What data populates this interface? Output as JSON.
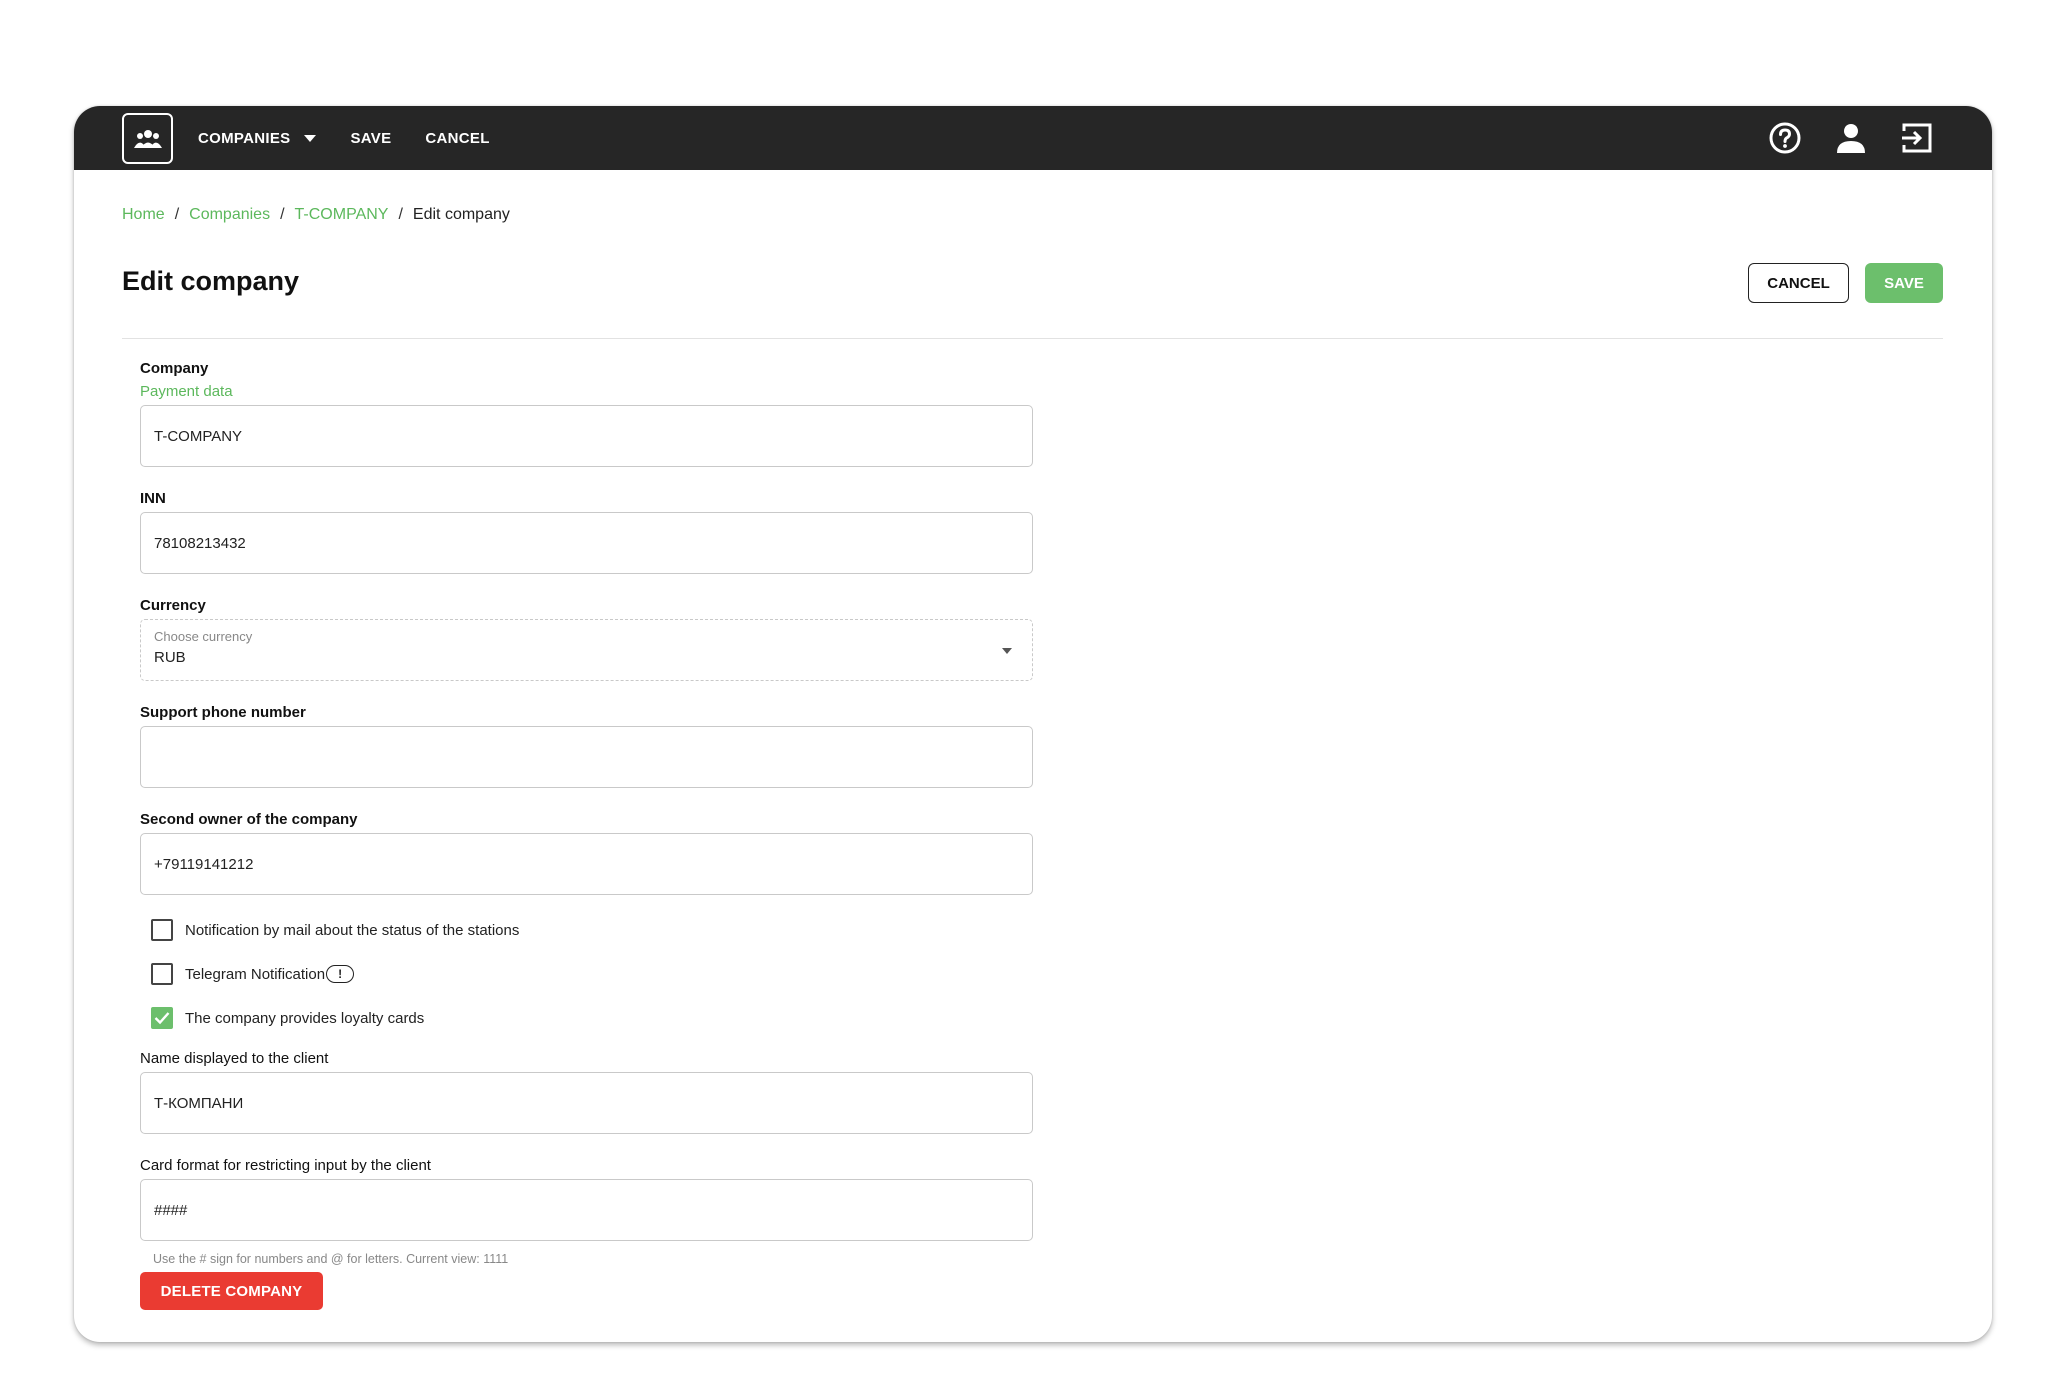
{
  "topbar": {
    "logo_icon": "team-icon",
    "nav": [
      {
        "label": "COMPANIES",
        "has_dropdown": true
      },
      {
        "label": "SAVE"
      },
      {
        "label": "CANCEL"
      }
    ],
    "icons": [
      "help-icon",
      "user-icon",
      "logout-icon"
    ]
  },
  "breadcrumb": {
    "items": [
      "Home",
      "Companies",
      "T-COMPANY"
    ],
    "separator": "/",
    "current": "Edit company"
  },
  "page": {
    "title": "Edit company",
    "cancel_label": "CANCEL",
    "save_label": "SAVE"
  },
  "form": {
    "company": {
      "label": "Company",
      "link": "Payment data",
      "value": "T-COMPANY"
    },
    "inn": {
      "label": "INN",
      "value": "78108213432"
    },
    "currency": {
      "label": "Currency",
      "placeholder": "Choose currency",
      "value": "RUB"
    },
    "support_phone": {
      "label": "Support phone number",
      "value": ""
    },
    "second_owner": {
      "label": "Second owner of the company",
      "value": "+79119141212"
    },
    "checkboxes": {
      "mail_notification": {
        "label": "Notification by mail about the status of the stations",
        "checked": false
      },
      "telegram_notification": {
        "label": "Telegram Notification",
        "badge": "!",
        "checked": false
      },
      "loyalty_cards": {
        "label": "The company provides loyalty cards",
        "checked": true
      }
    },
    "display_name": {
      "label": "Name displayed to the client",
      "value": "Т-КОМПАНИ"
    },
    "card_format": {
      "label": "Card format for restricting input by the client",
      "value": "####",
      "hint": "Use the # sign for numbers and @ for letters. Current view: 1111"
    },
    "delete_label": "DELETE COMPANY"
  },
  "colors": {
    "topbar_bg": "#262626",
    "accent_green": "#6cbf6c",
    "danger_red": "#ea3b32"
  }
}
